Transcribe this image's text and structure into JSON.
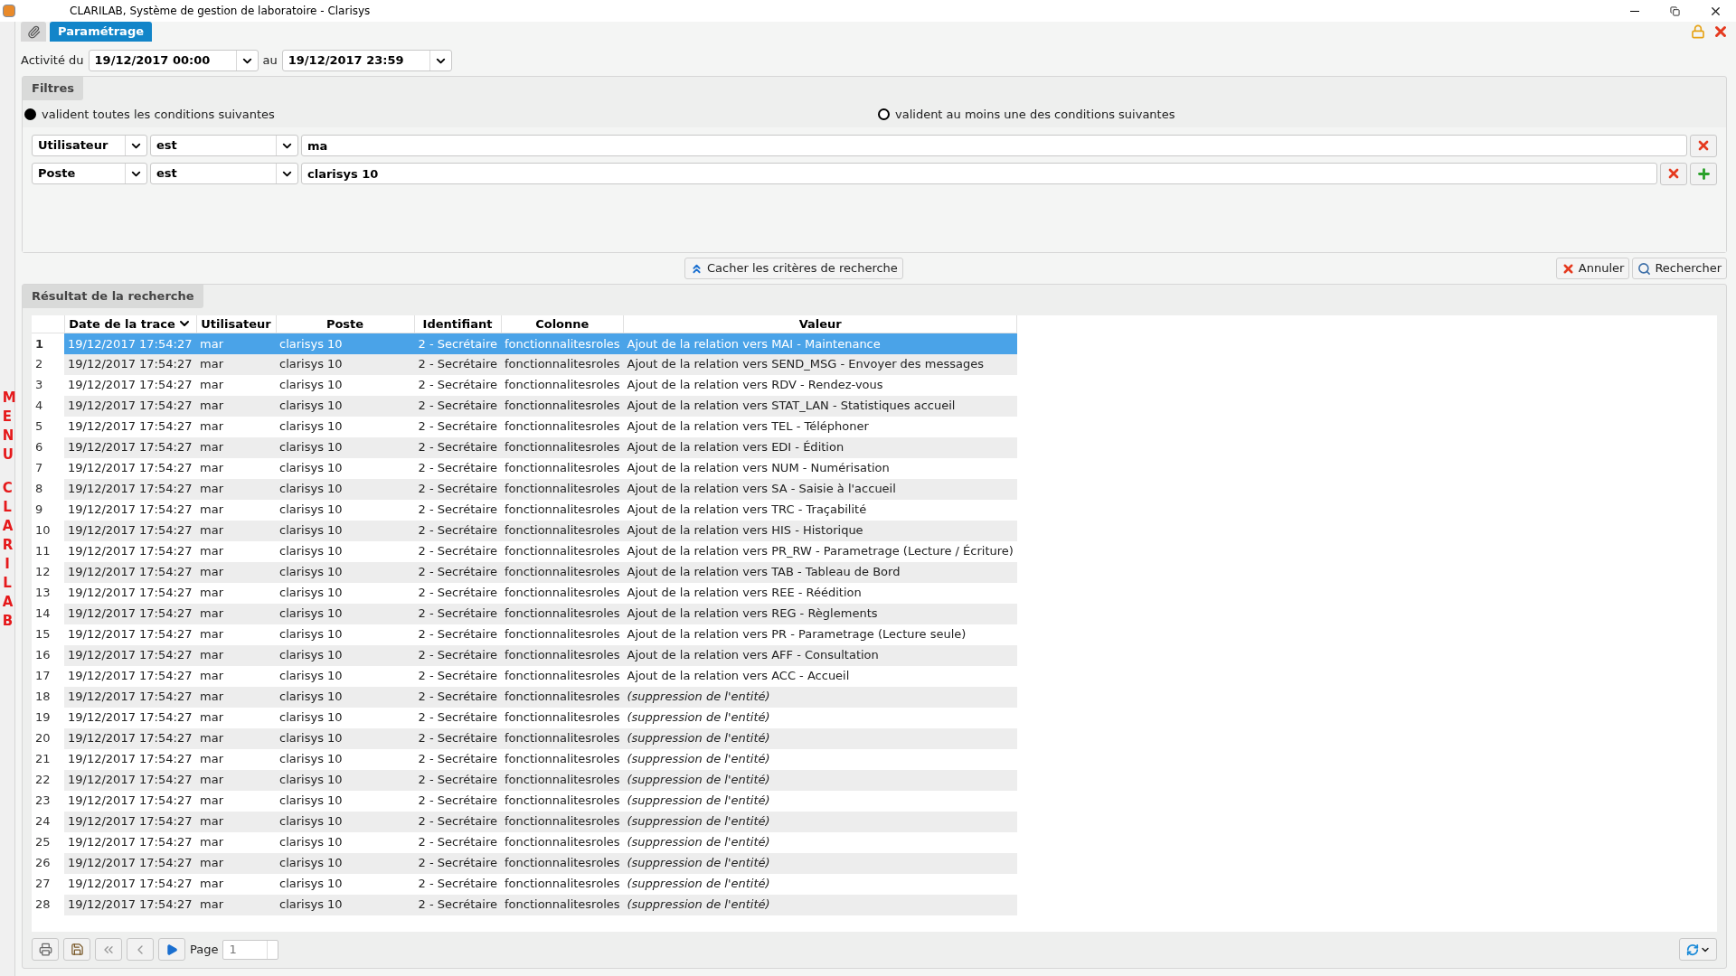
{
  "window": {
    "title": "CLARILAB, Système de gestion de laboratoire - Clarisys"
  },
  "tabs": [
    {
      "label": "Paramétrage",
      "selected": true
    }
  ],
  "side_menu": {
    "words": [
      "MENU",
      "CLARILAB"
    ]
  },
  "activity": {
    "label_from": "Activité du",
    "from": "19/12/2017 00:00",
    "label_to": "au",
    "to": "19/12/2017 23:59"
  },
  "filters": {
    "title": "Filtres",
    "modes": [
      {
        "label": "valident toutes les conditions suivantes",
        "selected": true
      },
      {
        "label": "valident au moins une des conditions suivantes",
        "selected": false
      }
    ],
    "conditions": [
      {
        "field": "Utilisateur",
        "operator": "est",
        "value": "ma",
        "add_button": false
      },
      {
        "field": "Poste",
        "operator": "est",
        "value": "clarisys 10",
        "add_button": true
      }
    ]
  },
  "actions": {
    "hide_criteria": "Cacher les critères de recherche",
    "cancel": "Annuler",
    "search": "Rechercher"
  },
  "results": {
    "title": "Résultat de la recherche",
    "columns": [
      {
        "sorted": false
      },
      {
        "label": "Date de la trace",
        "sorted": true
      },
      {
        "label": "Utilisateur",
        "sorted": false
      },
      {
        "label": "Poste",
        "sorted": false
      },
      {
        "label": "Identifiant",
        "sorted": false
      },
      {
        "label": "Colonne",
        "sorted": false
      },
      {
        "label": "Valeur",
        "sorted": false
      }
    ],
    "rows": [
      {
        "num": "1",
        "date": "19/12/2017 17:54:27",
        "user": "mar",
        "poste": "clarisys 10",
        "ident": "2 - Secrétaire",
        "col": "fonctionnalitesroles",
        "value": "Ajout de la relation vers MAI - Maintenance",
        "kind": "relation",
        "selected": true
      },
      {
        "num": "2",
        "date": "19/12/2017 17:54:27",
        "user": "mar",
        "poste": "clarisys 10",
        "ident": "2 - Secrétaire",
        "col": "fonctionnalitesroles",
        "value": "Ajout de la relation vers SEND_MSG - Envoyer des messages",
        "kind": "relation",
        "selected": false
      },
      {
        "num": "3",
        "date": "19/12/2017 17:54:27",
        "user": "mar",
        "poste": "clarisys 10",
        "ident": "2 - Secrétaire",
        "col": "fonctionnalitesroles",
        "value": "Ajout de la relation vers RDV - Rendez-vous",
        "kind": "relation",
        "selected": false
      },
      {
        "num": "4",
        "date": "19/12/2017 17:54:27",
        "user": "mar",
        "poste": "clarisys 10",
        "ident": "2 - Secrétaire",
        "col": "fonctionnalitesroles",
        "value": "Ajout de la relation vers STAT_LAN - Statistiques accueil",
        "kind": "relation",
        "selected": false
      },
      {
        "num": "5",
        "date": "19/12/2017 17:54:27",
        "user": "mar",
        "poste": "clarisys 10",
        "ident": "2 - Secrétaire",
        "col": "fonctionnalitesroles",
        "value": "Ajout de la relation vers TEL - Téléphoner",
        "kind": "relation",
        "selected": false
      },
      {
        "num": "6",
        "date": "19/12/2017 17:54:27",
        "user": "mar",
        "poste": "clarisys 10",
        "ident": "2 - Secrétaire",
        "col": "fonctionnalitesroles",
        "value": "Ajout de la relation vers EDI - Édition",
        "kind": "relation",
        "selected": false
      },
      {
        "num": "7",
        "date": "19/12/2017 17:54:27",
        "user": "mar",
        "poste": "clarisys 10",
        "ident": "2 - Secrétaire",
        "col": "fonctionnalitesroles",
        "value": "Ajout de la relation vers NUM - Numérisation",
        "kind": "relation",
        "selected": false
      },
      {
        "num": "8",
        "date": "19/12/2017 17:54:27",
        "user": "mar",
        "poste": "clarisys 10",
        "ident": "2 - Secrétaire",
        "col": "fonctionnalitesroles",
        "value": "Ajout de la relation vers SA - Saisie à l'accueil",
        "kind": "relation",
        "selected": false
      },
      {
        "num": "9",
        "date": "19/12/2017 17:54:27",
        "user": "mar",
        "poste": "clarisys 10",
        "ident": "2 - Secrétaire",
        "col": "fonctionnalitesroles",
        "value": "Ajout de la relation vers TRC - Traçabilité",
        "kind": "relation",
        "selected": false
      },
      {
        "num": "10",
        "date": "19/12/2017 17:54:27",
        "user": "mar",
        "poste": "clarisys 10",
        "ident": "2 - Secrétaire",
        "col": "fonctionnalitesroles",
        "value": "Ajout de la relation vers HIS - Historique",
        "kind": "relation",
        "selected": false
      },
      {
        "num": "11",
        "date": "19/12/2017 17:54:27",
        "user": "mar",
        "poste": "clarisys 10",
        "ident": "2 - Secrétaire",
        "col": "fonctionnalitesroles",
        "value": "Ajout de la relation vers PR_RW - Parametrage (Lecture / Écriture)",
        "kind": "relation",
        "selected": false
      },
      {
        "num": "12",
        "date": "19/12/2017 17:54:27",
        "user": "mar",
        "poste": "clarisys 10",
        "ident": "2 - Secrétaire",
        "col": "fonctionnalitesroles",
        "value": "Ajout de la relation vers TAB - Tableau de Bord",
        "kind": "relation",
        "selected": false
      },
      {
        "num": "13",
        "date": "19/12/2017 17:54:27",
        "user": "mar",
        "poste": "clarisys 10",
        "ident": "2 - Secrétaire",
        "col": "fonctionnalitesroles",
        "value": "Ajout de la relation vers REE - Réédition",
        "kind": "relation",
        "selected": false
      },
      {
        "num": "14",
        "date": "19/12/2017 17:54:27",
        "user": "mar",
        "poste": "clarisys 10",
        "ident": "2 - Secrétaire",
        "col": "fonctionnalitesroles",
        "value": "Ajout de la relation vers REG - Règlements",
        "kind": "relation",
        "selected": false
      },
      {
        "num": "15",
        "date": "19/12/2017 17:54:27",
        "user": "mar",
        "poste": "clarisys 10",
        "ident": "2 - Secrétaire",
        "col": "fonctionnalitesroles",
        "value": "Ajout de la relation vers PR - Parametrage (Lecture seule)",
        "kind": "relation",
        "selected": false
      },
      {
        "num": "16",
        "date": "19/12/2017 17:54:27",
        "user": "mar",
        "poste": "clarisys 10",
        "ident": "2 - Secrétaire",
        "col": "fonctionnalitesroles",
        "value": "Ajout de la relation vers AFF - Consultation",
        "kind": "relation",
        "selected": false
      },
      {
        "num": "17",
        "date": "19/12/2017 17:54:27",
        "user": "mar",
        "poste": "clarisys 10",
        "ident": "2 - Secrétaire",
        "col": "fonctionnalitesroles",
        "value": "Ajout de la relation vers ACC - Accueil",
        "kind": "relation",
        "selected": false
      },
      {
        "num": "18",
        "date": "19/12/2017 17:54:27",
        "user": "mar",
        "poste": "clarisys 10",
        "ident": "2 - Secrétaire",
        "col": "fonctionnalitesroles",
        "value": "(suppression de l'entité)",
        "kind": "deletion",
        "selected": false
      },
      {
        "num": "19",
        "date": "19/12/2017 17:54:27",
        "user": "mar",
        "poste": "clarisys 10",
        "ident": "2 - Secrétaire",
        "col": "fonctionnalitesroles",
        "value": "(suppression de l'entité)",
        "kind": "deletion",
        "selected": false
      },
      {
        "num": "20",
        "date": "19/12/2017 17:54:27",
        "user": "mar",
        "poste": "clarisys 10",
        "ident": "2 - Secrétaire",
        "col": "fonctionnalitesroles",
        "value": "(suppression de l'entité)",
        "kind": "deletion",
        "selected": false
      },
      {
        "num": "21",
        "date": "19/12/2017 17:54:27",
        "user": "mar",
        "poste": "clarisys 10",
        "ident": "2 - Secrétaire",
        "col": "fonctionnalitesroles",
        "value": "(suppression de l'entité)",
        "kind": "deletion",
        "selected": false
      },
      {
        "num": "22",
        "date": "19/12/2017 17:54:27",
        "user": "mar",
        "poste": "clarisys 10",
        "ident": "2 - Secrétaire",
        "col": "fonctionnalitesroles",
        "value": "(suppression de l'entité)",
        "kind": "deletion",
        "selected": false
      },
      {
        "num": "23",
        "date": "19/12/2017 17:54:27",
        "user": "mar",
        "poste": "clarisys 10",
        "ident": "2 - Secrétaire",
        "col": "fonctionnalitesroles",
        "value": "(suppression de l'entité)",
        "kind": "deletion",
        "selected": false
      },
      {
        "num": "24",
        "date": "19/12/2017 17:54:27",
        "user": "mar",
        "poste": "clarisys 10",
        "ident": "2 - Secrétaire",
        "col": "fonctionnalitesroles",
        "value": "(suppression de l'entité)",
        "kind": "deletion",
        "selected": false
      },
      {
        "num": "25",
        "date": "19/12/2017 17:54:27",
        "user": "mar",
        "poste": "clarisys 10",
        "ident": "2 - Secrétaire",
        "col": "fonctionnalitesroles",
        "value": "(suppression de l'entité)",
        "kind": "deletion",
        "selected": false
      },
      {
        "num": "26",
        "date": "19/12/2017 17:54:27",
        "user": "mar",
        "poste": "clarisys 10",
        "ident": "2 - Secrétaire",
        "col": "fonctionnalitesroles",
        "value": "(suppression de l'entité)",
        "kind": "deletion",
        "selected": false
      },
      {
        "num": "27",
        "date": "19/12/2017 17:54:27",
        "user": "mar",
        "poste": "clarisys 10",
        "ident": "2 - Secrétaire",
        "col": "fonctionnalitesroles",
        "value": "(suppression de l'entité)",
        "kind": "deletion",
        "selected": false
      },
      {
        "num": "28",
        "date": "19/12/2017 17:54:27",
        "user": "mar",
        "poste": "clarisys 10",
        "ident": "2 - Secrétaire",
        "col": "fonctionnalitesroles",
        "value": "(suppression de l'entité)",
        "kind": "deletion",
        "selected": false
      }
    ]
  },
  "pager": {
    "label": "Page",
    "page": "1"
  }
}
